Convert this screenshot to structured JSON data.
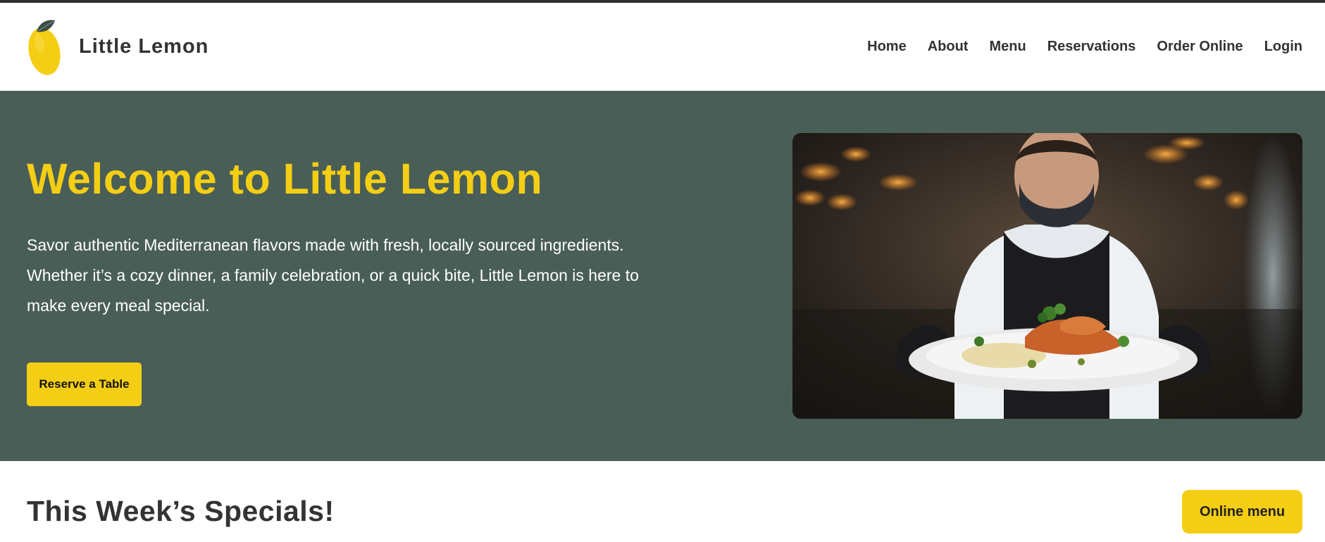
{
  "header": {
    "brand_name": "Little Lemon",
    "logo_icon": "lemon-icon",
    "nav": [
      {
        "label": "Home"
      },
      {
        "label": "About"
      },
      {
        "label": "Menu"
      },
      {
        "label": "Reservations"
      },
      {
        "label": "Order Online"
      },
      {
        "label": "Login"
      }
    ]
  },
  "hero": {
    "title": "Welcome to Little Lemon",
    "description": "Savor authentic Mediterranean flavors made with fresh, locally sourced ingredients. Whether it’s a cozy dinner, a family celebration, or a quick bite, Little Lemon is here to make every meal special.",
    "cta_label": "Reserve a Table",
    "image_subject": "chef-serving-plate-photo"
  },
  "specials": {
    "title": "This Week’s Specials!",
    "button_label": "Online menu"
  },
  "colors": {
    "brand_green": "#495e57",
    "brand_yellow": "#f4ce14",
    "text_dark": "#333333"
  }
}
